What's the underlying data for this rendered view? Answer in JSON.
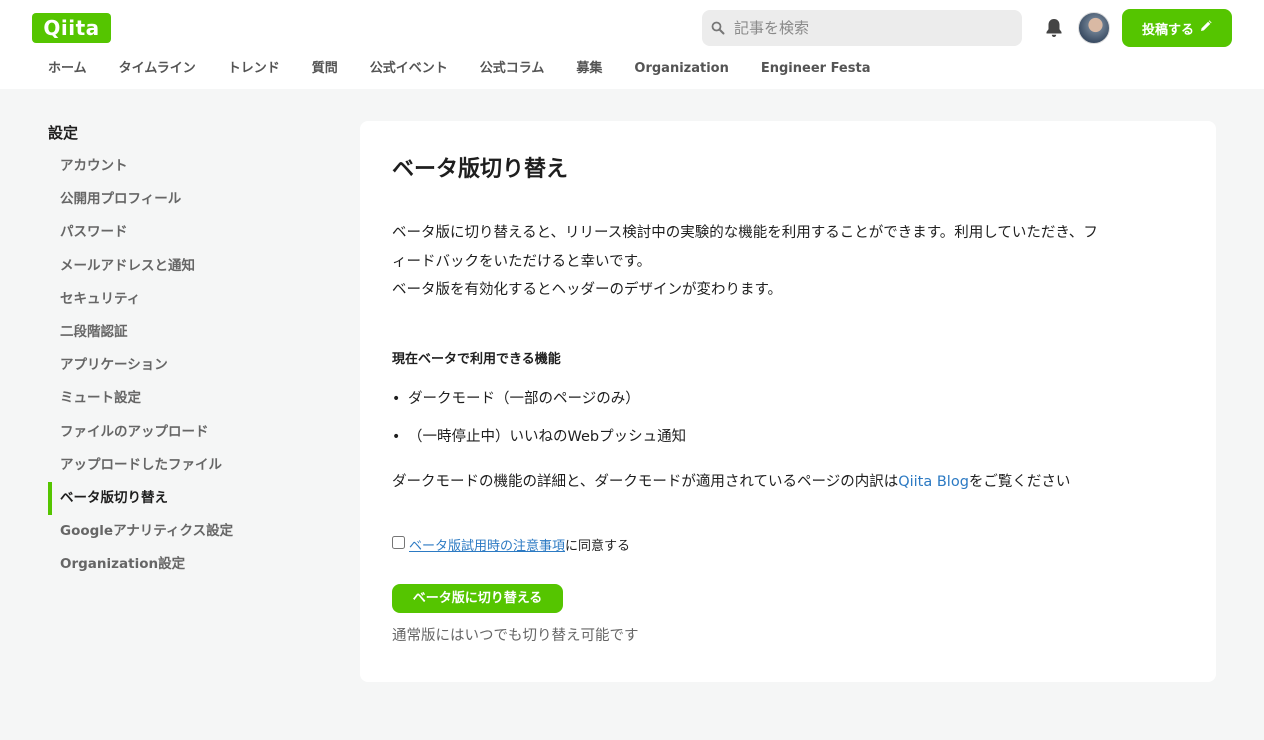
{
  "header": {
    "logo_text": "Qiita",
    "search_placeholder": "記事を検索",
    "post_label": "投稿する",
    "brand_color": "#55c500"
  },
  "nav": {
    "items": [
      "ホーム",
      "タイムライン",
      "トレンド",
      "質問",
      "公式イベント",
      "公式コラム",
      "募集",
      "Organization",
      "Engineer Festa"
    ]
  },
  "sidebar": {
    "title": "設定",
    "items": [
      {
        "label": "アカウント"
      },
      {
        "label": "公開用プロフィール"
      },
      {
        "label": "パスワード"
      },
      {
        "label": "メールアドレスと通知"
      },
      {
        "label": "セキュリティ"
      },
      {
        "label": "二段階認証"
      },
      {
        "label": "アプリケーション"
      },
      {
        "label": "ミュート設定"
      },
      {
        "label": "ファイルのアップロード"
      },
      {
        "label": "アップロードしたファイル"
      },
      {
        "label": "ベータ版切り替え",
        "active": true
      },
      {
        "label": "Googleアナリティクス設定"
      },
      {
        "label": "Organization設定"
      }
    ]
  },
  "main": {
    "title": "ベータ版切り替え",
    "desc_line1": "ベータ版に切り替えると、リリース検討中の実験的な機能を利用することができます。利用していただき、フ",
    "desc_line2": "ィードバックをいただけると幸いです。",
    "desc_line3": "ベータ版を有効化するとヘッダーのデザインが変わります。",
    "features_title": "現在ベータで利用できる機能",
    "features": [
      "ダークモード（一部のページのみ）",
      "（一時停止中）いいねのWebプッシュ通知"
    ],
    "blog_prefix": "ダークモードの機能の詳細と、ダークモードが適用されているページの内訳は",
    "blog_link": "Qiita Blog",
    "blog_suffix": "をご覧ください",
    "agree_link": "ベータ版試用時の注意事項",
    "agree_suffix": "に同意する",
    "agree_checked": false,
    "switch_button": "ベータ版に切り替える",
    "note": "通常版にはいつでも切り替え可能です"
  }
}
